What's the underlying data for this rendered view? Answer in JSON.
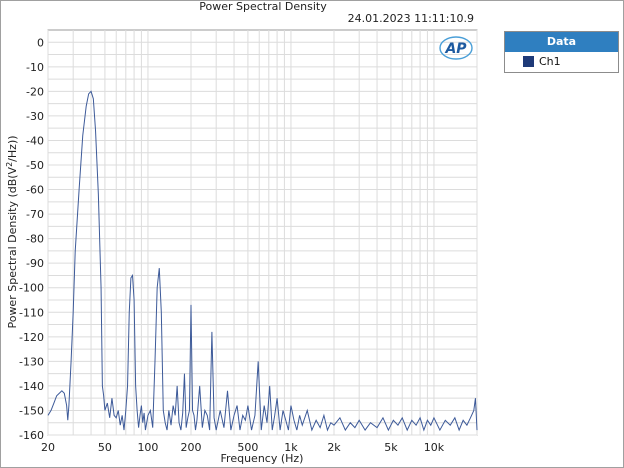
{
  "chart_data": {
    "type": "line",
    "title": "Power Spectral Density",
    "timestamp": "24.01.2023 11:11:10.9",
    "xlabel": "Frequency (Hz)",
    "ylabel_pre": "Power Spectral Density (dB(V",
    "ylabel_sup": "2",
    "ylabel_post": "/Hz))",
    "xscale": "log",
    "xlim": [
      20,
      20000
    ],
    "ylim": [
      -160,
      5
    ],
    "x_ticks": [
      {
        "value": 20,
        "label": "20"
      },
      {
        "value": 50,
        "label": "50"
      },
      {
        "value": 100,
        "label": "100"
      },
      {
        "value": 200,
        "label": "200"
      },
      {
        "value": 500,
        "label": "500"
      },
      {
        "value": 1000,
        "label": "1k"
      },
      {
        "value": 2000,
        "label": "2k"
      },
      {
        "value": 5000,
        "label": "5k"
      },
      {
        "value": 10000,
        "label": "10k"
      }
    ],
    "y_ticks": [
      0,
      -10,
      -20,
      -30,
      -40,
      -50,
      -60,
      -70,
      -80,
      -90,
      -100,
      -110,
      -120,
      -130,
      -140,
      -150,
      -160
    ],
    "grid": true,
    "legend": {
      "title": "Data",
      "position": "top-right-outside"
    },
    "series": [
      {
        "name": "Ch1",
        "color": "#3d5a99",
        "points": [
          [
            20,
            -152
          ],
          [
            21,
            -150
          ],
          [
            22,
            -147
          ],
          [
            23,
            -144
          ],
          [
            24,
            -143
          ],
          [
            25,
            -142
          ],
          [
            26,
            -143
          ],
          [
            27,
            -148
          ],
          [
            27.5,
            -154
          ],
          [
            28,
            -148
          ],
          [
            29,
            -130
          ],
          [
            30,
            -110
          ],
          [
            31,
            -85
          ],
          [
            33,
            -60
          ],
          [
            35,
            -38
          ],
          [
            37,
            -26
          ],
          [
            38.5,
            -21
          ],
          [
            40,
            -20
          ],
          [
            41.5,
            -23
          ],
          [
            43,
            -36
          ],
          [
            45,
            -62
          ],
          [
            47,
            -100
          ],
          [
            48,
            -140
          ],
          [
            49,
            -144
          ],
          [
            50,
            -150
          ],
          [
            52,
            -147
          ],
          [
            54,
            -153
          ],
          [
            56,
            -145
          ],
          [
            58,
            -152
          ],
          [
            60,
            -153
          ],
          [
            62,
            -150
          ],
          [
            64,
            -156
          ],
          [
            66,
            -152
          ],
          [
            68,
            -158
          ],
          [
            70,
            -150
          ],
          [
            72,
            -140
          ],
          [
            74,
            -110
          ],
          [
            76,
            -96
          ],
          [
            78,
            -95
          ],
          [
            80,
            -105
          ],
          [
            82,
            -140
          ],
          [
            84,
            -150
          ],
          [
            86,
            -157
          ],
          [
            88,
            -152
          ],
          [
            90,
            -148
          ],
          [
            92,
            -155
          ],
          [
            94,
            -151
          ],
          [
            96,
            -158
          ],
          [
            100,
            -152
          ],
          [
            104,
            -150
          ],
          [
            108,
            -157
          ],
          [
            112,
            -130
          ],
          [
            116,
            -100
          ],
          [
            120,
            -92
          ],
          [
            124,
            -110
          ],
          [
            128,
            -150
          ],
          [
            132,
            -155
          ],
          [
            136,
            -158
          ],
          [
            140,
            -150
          ],
          [
            145,
            -156
          ],
          [
            150,
            -148
          ],
          [
            155,
            -152
          ],
          [
            160,
            -140
          ],
          [
            165,
            -155
          ],
          [
            170,
            -158
          ],
          [
            175,
            -151
          ],
          [
            180,
            -135
          ],
          [
            185,
            -157
          ],
          [
            190,
            -153
          ],
          [
            195,
            -150
          ],
          [
            200,
            -107
          ],
          [
            205,
            -150
          ],
          [
            210,
            -152
          ],
          [
            215,
            -158
          ],
          [
            220,
            -154
          ],
          [
            230,
            -140
          ],
          [
            240,
            -157
          ],
          [
            250,
            -150
          ],
          [
            260,
            -152
          ],
          [
            270,
            -158
          ],
          [
            280,
            -118
          ],
          [
            290,
            -153
          ],
          [
            300,
            -158
          ],
          [
            320,
            -150
          ],
          [
            340,
            -157
          ],
          [
            360,
            -142
          ],
          [
            380,
            -158
          ],
          [
            400,
            -152
          ],
          [
            420,
            -148
          ],
          [
            440,
            -158
          ],
          [
            460,
            -152
          ],
          [
            480,
            -154
          ],
          [
            500,
            -148
          ],
          [
            530,
            -158
          ],
          [
            560,
            -152
          ],
          [
            590,
            -130
          ],
          [
            620,
            -158
          ],
          [
            650,
            -148
          ],
          [
            680,
            -155
          ],
          [
            710,
            -140
          ],
          [
            740,
            -158
          ],
          [
            770,
            -152
          ],
          [
            800,
            -145
          ],
          [
            840,
            -158
          ],
          [
            880,
            -150
          ],
          [
            920,
            -154
          ],
          [
            960,
            -158
          ],
          [
            1000,
            -148
          ],
          [
            1050,
            -154
          ],
          [
            1100,
            -158
          ],
          [
            1150,
            -152
          ],
          [
            1200,
            -156
          ],
          [
            1300,
            -150
          ],
          [
            1400,
            -158
          ],
          [
            1500,
            -154
          ],
          [
            1600,
            -157
          ],
          [
            1700,
            -152
          ],
          [
            1800,
            -158
          ],
          [
            1900,
            -155
          ],
          [
            2000,
            -156
          ],
          [
            2200,
            -153
          ],
          [
            2400,
            -158
          ],
          [
            2600,
            -155
          ],
          [
            2800,
            -157
          ],
          [
            3000,
            -154
          ],
          [
            3300,
            -158
          ],
          [
            3600,
            -155
          ],
          [
            4000,
            -157
          ],
          [
            4400,
            -153
          ],
          [
            4800,
            -158
          ],
          [
            5200,
            -154
          ],
          [
            5600,
            -156
          ],
          [
            6000,
            -153
          ],
          [
            6500,
            -158
          ],
          [
            7000,
            -154
          ],
          [
            7500,
            -156
          ],
          [
            8000,
            -153
          ],
          [
            8500,
            -158
          ],
          [
            9000,
            -154
          ],
          [
            9500,
            -156
          ],
          [
            10000,
            -153
          ],
          [
            11000,
            -158
          ],
          [
            12000,
            -154
          ],
          [
            13000,
            -156
          ],
          [
            14000,
            -153
          ],
          [
            15000,
            -158
          ],
          [
            16000,
            -154
          ],
          [
            17000,
            -156
          ],
          [
            18000,
            -153
          ],
          [
            19000,
            -150
          ],
          [
            19500,
            -145
          ],
          [
            20000,
            -158
          ]
        ]
      }
    ]
  }
}
